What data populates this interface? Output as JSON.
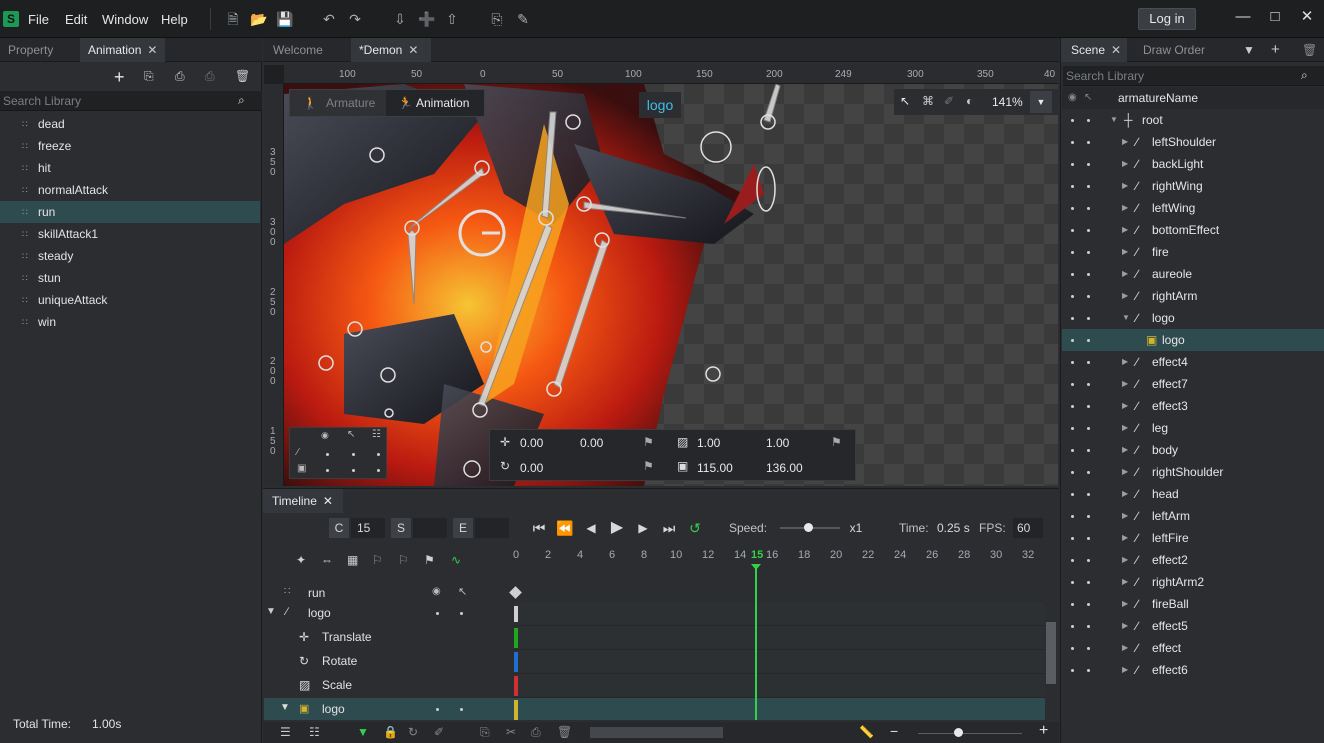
{
  "menu": {
    "file": "File",
    "edit": "Edit",
    "window": "Window",
    "help": "Help",
    "login": "Log in"
  },
  "left_tabs": {
    "property": "Property",
    "animation": "Animation"
  },
  "left_search": "Search Library",
  "animations": [
    "dead",
    "freeze",
    "hit",
    "normalAttack",
    "run",
    "skillAttack1",
    "steady",
    "stun",
    "uniqueAttack",
    "win"
  ],
  "selected_animation": "run",
  "total_time": {
    "label": "Total Time:",
    "value": "1.00s"
  },
  "doc_tabs": {
    "welcome": "Welcome",
    "demon": "*Demon"
  },
  "ruler_top": [
    "100",
    "50",
    "0",
    "50",
    "100",
    "150",
    "200",
    "249",
    "300",
    "350",
    "40"
  ],
  "ruler_left": [
    "350",
    "300",
    "250",
    "200",
    "150"
  ],
  "mode": {
    "armature": "Armature",
    "animation": "Animation"
  },
  "logo_label": "logo",
  "zoom": "141%",
  "transform": {
    "x": "0.00",
    "y": "0.00",
    "rotate": "0.00",
    "scale_x": "1.00",
    "scale_y": "1.00",
    "width": "115.00",
    "height": "136.00"
  },
  "timeline": {
    "title": "Timeline",
    "c_label": "C",
    "frame": "15",
    "s_label": "S",
    "e_label": "E",
    "speed_label": "Speed:",
    "speed": "x1",
    "time_label": "Time:",
    "time": "0.25 s",
    "fps_label": "FPS:",
    "fps": "60",
    "ticks": [
      "0",
      "2",
      "4",
      "6",
      "8",
      "10",
      "12",
      "14",
      "15",
      "16",
      "18",
      "20",
      "22",
      "24",
      "26",
      "28",
      "30",
      "32"
    ],
    "rows": [
      "run",
      "logo",
      "Translate",
      "Rotate",
      "Scale",
      "logo"
    ]
  },
  "scene_tabs": {
    "scene": "Scene",
    "draw_order": "Draw Order"
  },
  "scene_search": "Search Library",
  "tree": {
    "armature": "armatureName",
    "root": "root",
    "bones": [
      "leftShoulder",
      "backLight",
      "rightWing",
      "leftWing",
      "bottomEffect",
      "fire",
      "aureole",
      "rightArm",
      "logo",
      "logo",
      "effect4",
      "effect7",
      "effect3",
      "leg",
      "body",
      "rightShoulder",
      "head",
      "leftArm",
      "leftFire",
      "effect2",
      "rightArm2",
      "fireBall",
      "effect5",
      "effect",
      "effect6"
    ]
  },
  "colors": {
    "accent": "#2e4b4f",
    "playhead": "#33d14a",
    "translate": "#1fa81f",
    "rotate": "#1f6fd1",
    "scale": "#d13030",
    "image": "#d1b430"
  }
}
